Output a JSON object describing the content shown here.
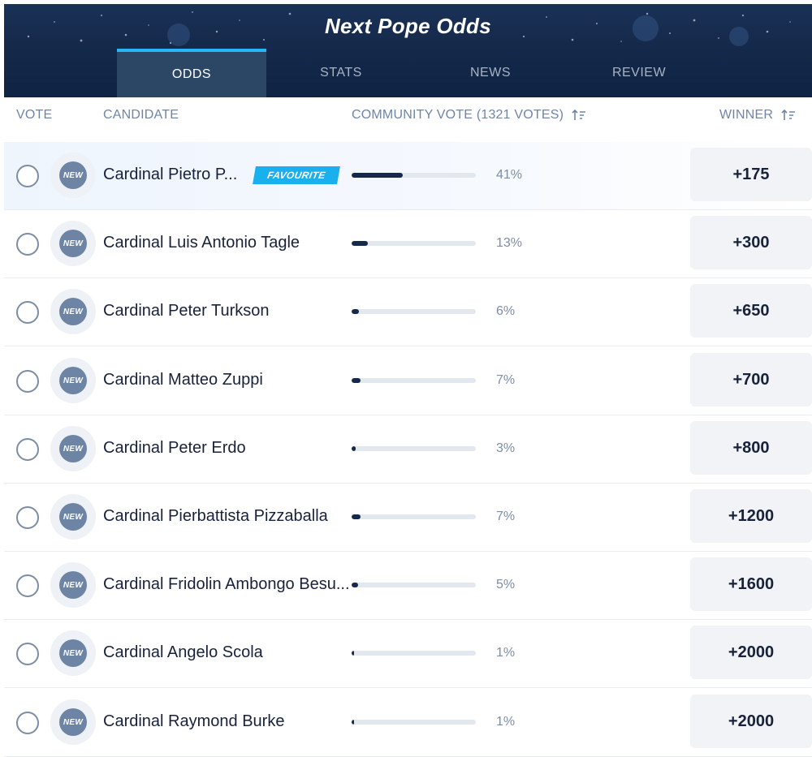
{
  "header": {
    "title": "Next Pope Odds",
    "tabs": [
      {
        "label": "ODDS",
        "active": true
      },
      {
        "label": "STATS",
        "active": false
      },
      {
        "label": "NEWS",
        "active": false
      },
      {
        "label": "REVIEW",
        "active": false
      }
    ]
  },
  "columns": {
    "vote": "VOTE",
    "candidate": "CANDIDATE",
    "community": "COMMUNITY VOTE (1321 VOTES)",
    "winner": "WINNER"
  },
  "badge_label": "NEW",
  "favourite_label": "FAVOURITE",
  "colors": {
    "header_bg": "#15294a",
    "active_tab_bg": "#2c4666",
    "active_tab_accent": "#29b6f6",
    "favourite_tag": "#1ab0ee",
    "bar_fill": "#15294a",
    "badge": "#6d84a5"
  },
  "candidates": [
    {
      "name": "Cardinal Pietro P...",
      "pct_label": "41%",
      "vote_fraction": 0.41,
      "odds": "+175",
      "favourite": true
    },
    {
      "name": "Cardinal Luis Antonio Tagle",
      "pct_label": "13%",
      "vote_fraction": 0.13,
      "odds": "+300",
      "favourite": false
    },
    {
      "name": "Cardinal Peter Turkson",
      "pct_label": "6%",
      "vote_fraction": 0.06,
      "odds": "+650",
      "favourite": false
    },
    {
      "name": "Cardinal Matteo Zuppi",
      "pct_label": "7%",
      "vote_fraction": 0.07,
      "odds": "+700",
      "favourite": false
    },
    {
      "name": "Cardinal Peter Erdo",
      "pct_label": "3%",
      "vote_fraction": 0.03,
      "odds": "+800",
      "favourite": false
    },
    {
      "name": "Cardinal Pierbattista Pizzaballa",
      "pct_label": "7%",
      "vote_fraction": 0.07,
      "odds": "+1200",
      "favourite": false
    },
    {
      "name": "Cardinal Fridolin Ambongo Besu...",
      "pct_label": "5%",
      "vote_fraction": 0.05,
      "odds": "+1600",
      "favourite": false
    },
    {
      "name": "Cardinal Angelo Scola",
      "pct_label": "1%",
      "vote_fraction": 0.01,
      "odds": "+2000",
      "favourite": false
    },
    {
      "name": "Cardinal Raymond Burke",
      "pct_label": "1%",
      "vote_fraction": 0.01,
      "odds": "+2000",
      "favourite": false
    }
  ]
}
